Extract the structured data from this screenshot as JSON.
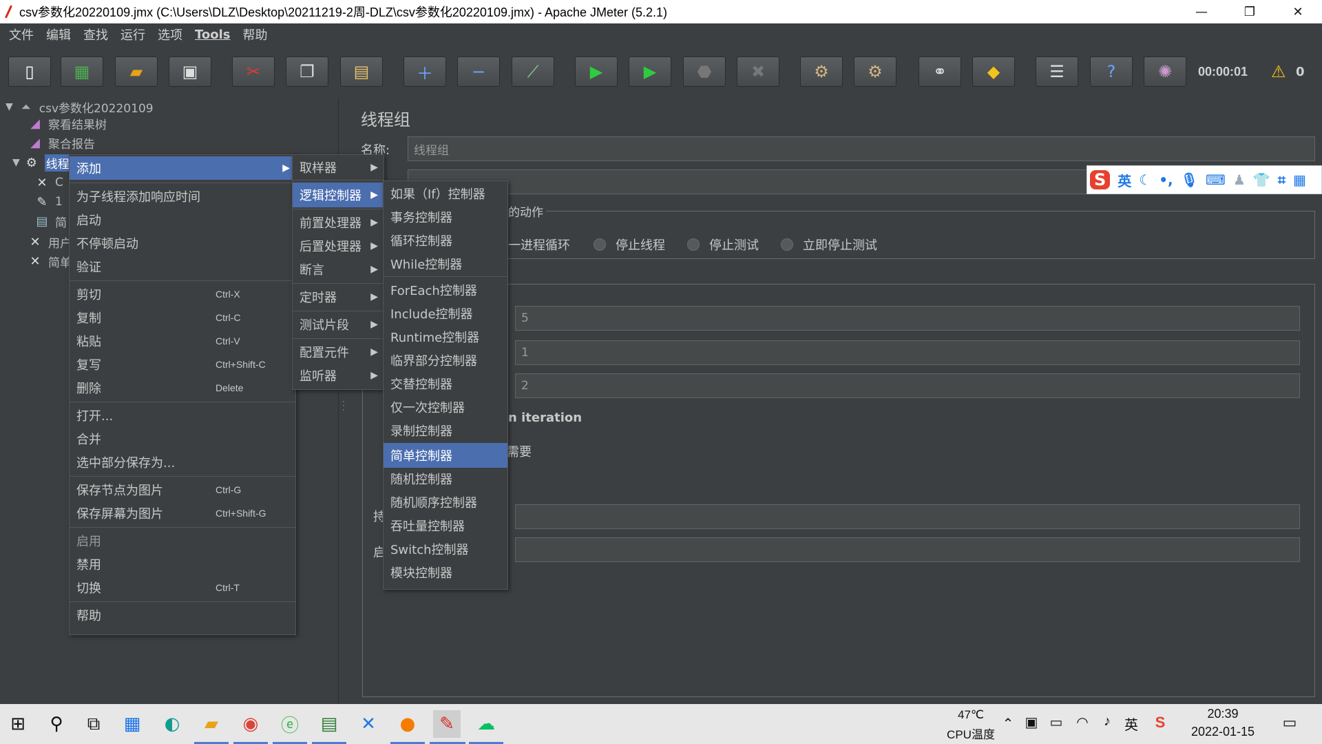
{
  "window": {
    "title": "csv参数化20220109.jmx (C:\\Users\\DLZ\\Desktop\\20211219-2周-DLZ\\csv参数化20220109.jmx) - Apache JMeter (5.2.1)",
    "minimize": "—",
    "maximize": "❐",
    "close": "✕"
  },
  "menubar": [
    "文件",
    "编辑",
    "查找",
    "运行",
    "选项",
    "Tools",
    "帮助"
  ],
  "toolbar": {
    "timer": "00:00:01",
    "warning_count": "0",
    "buttons": [
      "new-icon",
      "templates-icon",
      "open-icon",
      "save-icon",
      "cut-icon",
      "copy-icon",
      "paste-icon",
      "expand-icon",
      "collapse-icon",
      "toggle-icon",
      "start-icon",
      "start-no-pause-icon",
      "stop-icon",
      "shutdown-icon",
      "clear-icon",
      "clear-all-icon",
      "search-icon",
      "reset-search-icon",
      "function-helper-icon",
      "help-icon",
      "remote-icon"
    ]
  },
  "tree": {
    "root": "csv参数化20220109",
    "items": [
      "察看结果树",
      "聚合报告",
      "线程组",
      "C",
      "1",
      "简",
      "用户",
      "简单"
    ]
  },
  "right_panel": {
    "title": "线程组",
    "name_label": "名称:",
    "name_value": "线程组",
    "action_legend": "的动作",
    "radio_options": [
      "一进程循环",
      "停止线程",
      "停止测试",
      "立即停止测试"
    ],
    "field_values": [
      "5",
      "1",
      "2"
    ],
    "iteration_text": "n iteration",
    "need_text": "需要",
    "cut_label_1": "持",
    "cut_label_2": "启"
  },
  "ime": {
    "logo": "S",
    "lang": "英",
    "icons": [
      "moon-icon",
      "punct-icon",
      "mic-icon",
      "keyboard-icon",
      "user-icon",
      "shirt-icon",
      "crop-icon",
      "grid-icon"
    ]
  },
  "context_menu": {
    "items": [
      {
        "label": "添加",
        "shortcut": "",
        "submenu": true
      },
      {
        "label": "为子线程添加响应时间",
        "shortcut": ""
      },
      {
        "label": "启动",
        "shortcut": ""
      },
      {
        "label": "不停顿启动",
        "shortcut": ""
      },
      {
        "label": "验证",
        "shortcut": ""
      },
      {
        "label": "剪切",
        "shortcut": "Ctrl-X"
      },
      {
        "label": "复制",
        "shortcut": "Ctrl-C"
      },
      {
        "label": "粘贴",
        "shortcut": "Ctrl-V"
      },
      {
        "label": "复写",
        "shortcut": "Ctrl+Shift-C"
      },
      {
        "label": "删除",
        "shortcut": "Delete"
      },
      {
        "label": "打开...",
        "shortcut": ""
      },
      {
        "label": "合并",
        "shortcut": ""
      },
      {
        "label": "选中部分保存为...",
        "shortcut": ""
      },
      {
        "label": "保存节点为图片",
        "shortcut": "Ctrl-G"
      },
      {
        "label": "保存屏幕为图片",
        "shortcut": "Ctrl+Shift-G"
      },
      {
        "label": "启用",
        "shortcut": ""
      },
      {
        "label": "禁用",
        "shortcut": ""
      },
      {
        "label": "切换",
        "shortcut": "Ctrl-T"
      },
      {
        "label": "帮助",
        "shortcut": ""
      }
    ]
  },
  "add_submenu": [
    "取样器",
    "逻辑控制器",
    "前置处理器",
    "后置处理器",
    "断言",
    "定时器",
    "测试片段",
    "配置元件",
    "监听器"
  ],
  "logic_submenu": [
    "如果（If）控制器",
    "事务控制器",
    "循环控制器",
    "While控制器",
    "ForEach控制器",
    "Include控制器",
    "Runtime控制器",
    "临界部分控制器",
    "交替控制器",
    "仅一次控制器",
    "录制控制器",
    "简单控制器",
    "随机控制器",
    "随机顺序控制器",
    "吞吐量控制器",
    "Switch控制器",
    "模块控制器"
  ],
  "taskbar": {
    "temp": "47℃",
    "temp_label": "CPU温度",
    "ime_lang": "英",
    "time": "20:39",
    "date": "2022-01-15"
  },
  "colors": {
    "bg": "#3c3f41",
    "highlight": "#4b6eaf",
    "taskbar": "#e7e7e7"
  }
}
